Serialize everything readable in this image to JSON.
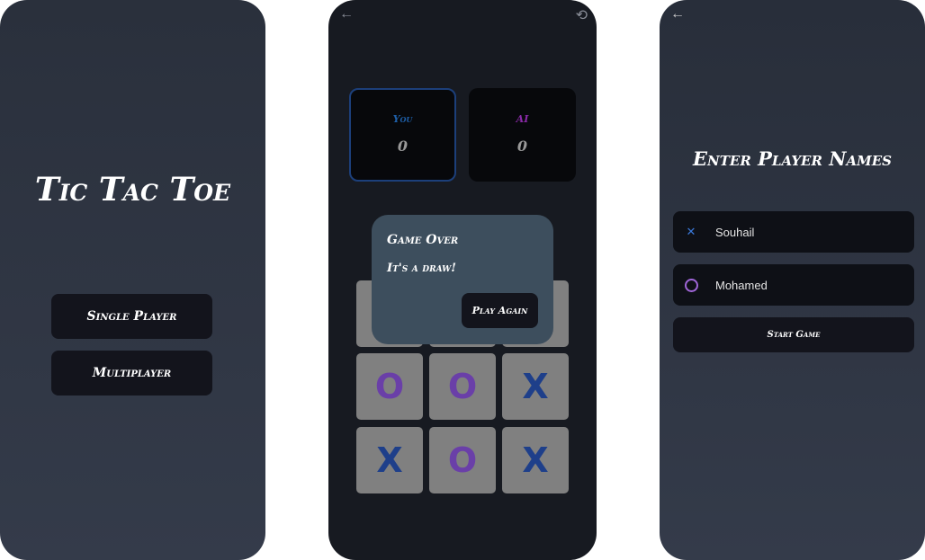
{
  "home": {
    "title": "Tic Tac Toe",
    "buttons": [
      "Single Player",
      "Multiplayer"
    ]
  },
  "game": {
    "icons": {
      "back": "arrow-left-icon",
      "history": "history-icon"
    },
    "scores": [
      {
        "label": "You",
        "score": "0",
        "color": "#1e5fa8"
      },
      {
        "label": "AI",
        "score": "0",
        "color": "#8a2aa8"
      }
    ],
    "board": [
      [
        "",
        "",
        ""
      ],
      [
        "O",
        "O",
        "X"
      ],
      [
        "X",
        "O",
        "X"
      ]
    ],
    "colors": {
      "x": "#1e3f8a",
      "o": "#6a3fa8"
    },
    "dialog": {
      "title": "Game Over",
      "message": "It's a draw!",
      "button": "Play Again"
    }
  },
  "setup": {
    "title": "Enter Player Names",
    "players": [
      {
        "icon": "x-icon",
        "name": "Souhail",
        "color": "#3a78d8"
      },
      {
        "icon": "circle-icon",
        "name": "Mohamed",
        "color": "#a066d8"
      }
    ],
    "start_button": "Start Game"
  }
}
